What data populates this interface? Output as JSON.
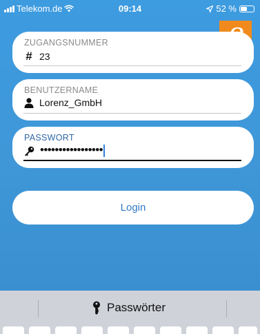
{
  "status_bar": {
    "carrier": "Telekom.de",
    "time": "09:14",
    "battery_text": "52 %",
    "battery_level": 0.52
  },
  "step_badge": "8",
  "form": {
    "access_number": {
      "label": "ZUGANGSNUMMER",
      "value": "23"
    },
    "username": {
      "label": "BENUTZERNAME",
      "value": "Lorenz_GmbH"
    },
    "password": {
      "label": "PASSWORT",
      "value": "•••••••••••••••••"
    }
  },
  "login_button": "Login",
  "keyboard": {
    "passwords_label": "Passwörter"
  },
  "icons": {
    "access_number": "hash-icon",
    "username": "person-icon",
    "password": "key-icon",
    "passwords": "keyhole-key-icon"
  },
  "colors": {
    "background": "#3d9be0",
    "badge": "#f08a1c",
    "active_label": "#2e67a7",
    "button_text": "#2f78c4",
    "keyboard": "#cfd2d9"
  }
}
